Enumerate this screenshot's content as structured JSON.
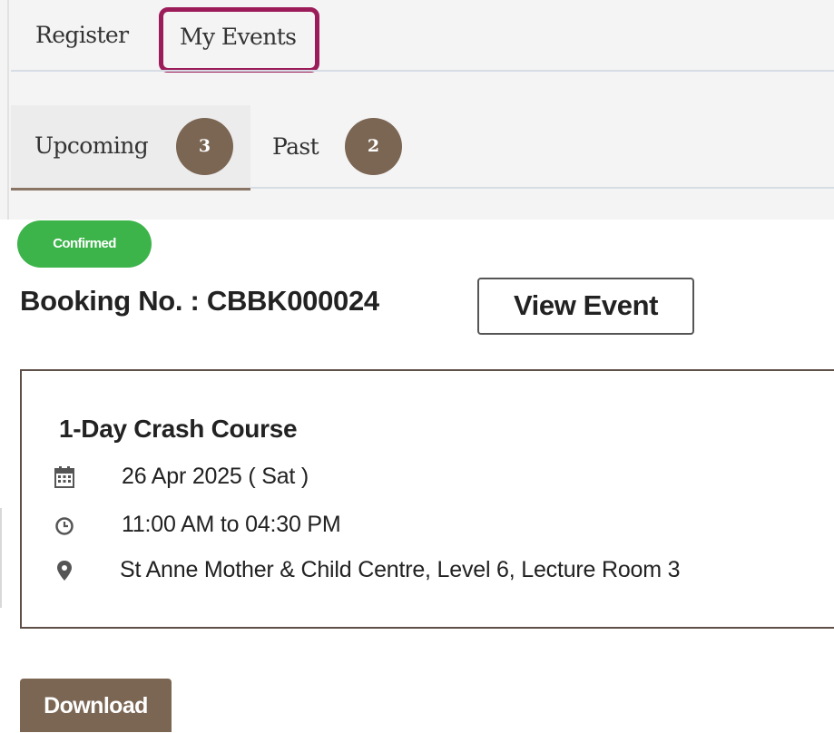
{
  "tabs": {
    "register_label": "Register",
    "my_events_label": "My Events",
    "highlight_color": "#9c1c5a"
  },
  "subtabs": {
    "upcoming_label": "Upcoming",
    "upcoming_count": "3",
    "past_label": "Past",
    "past_count": "2",
    "badge_color": "#7b6553"
  },
  "booking": {
    "status": "Confirmed",
    "status_color": "#3cb44a",
    "number_text": "Booking No. : CBBK000024",
    "view_event_label": "View Event"
  },
  "event": {
    "title": "1-Day Crash Course",
    "date": "26 Apr 2025 ( Sat )",
    "time": "11:00 AM to 04:30 PM",
    "location": "St Anne Mother & Child Centre, Level 6, Lecture Room 3",
    "date_icon": "calendar-icon",
    "time_icon": "clock-icon",
    "location_icon": "map-marker-icon"
  },
  "actions": {
    "download_label": "Download"
  }
}
